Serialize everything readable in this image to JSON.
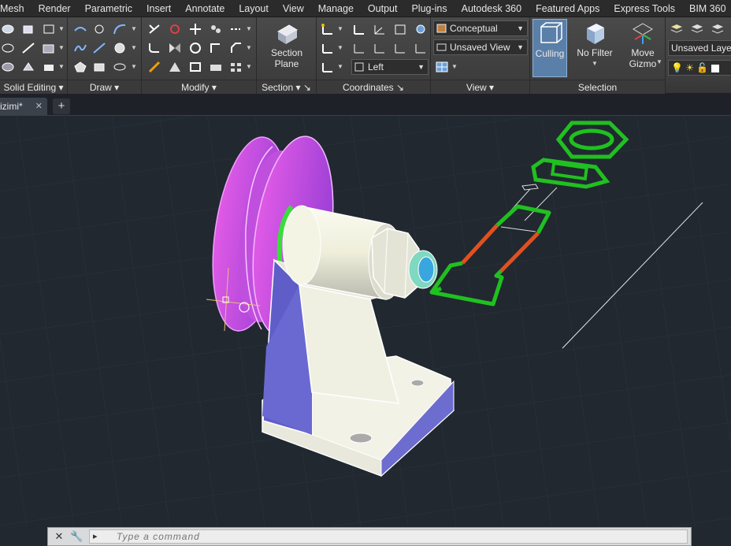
{
  "ribbon_tabs": [
    "Mesh",
    "Render",
    "Parametric",
    "Insert",
    "Annotate",
    "Layout",
    "View",
    "Manage",
    "Output",
    "Plug-ins",
    "Autodesk 360",
    "Featured Apps",
    "Express Tools",
    "BIM 360"
  ],
  "panels": {
    "solid_editing": "Solid Editing",
    "draw": "Draw",
    "modify": "Modify",
    "section": "Section",
    "coordinates": "Coordinates",
    "view": "View",
    "selection": "Selection"
  },
  "section_plane_label": "Section\nPlane",
  "visual_style": "Conceptual",
  "named_view": "Unsaved View",
  "ucs_view": "Left",
  "culling_label": "Culling",
  "no_filter_label": "No Filter",
  "move_gizmo_label": "Move\nGizmo",
  "layer_state": "Unsaved Layer",
  "document_tab": "izimi*",
  "new_tab_symbol": "+",
  "command_placeholder": "Type a command",
  "command_prompt_symbol": "▸",
  "colors": {
    "viewport_bg": "#212830",
    "pulley": "#b84de0",
    "bracket": "#eeeedd",
    "green_edge": "#22c41f"
  }
}
